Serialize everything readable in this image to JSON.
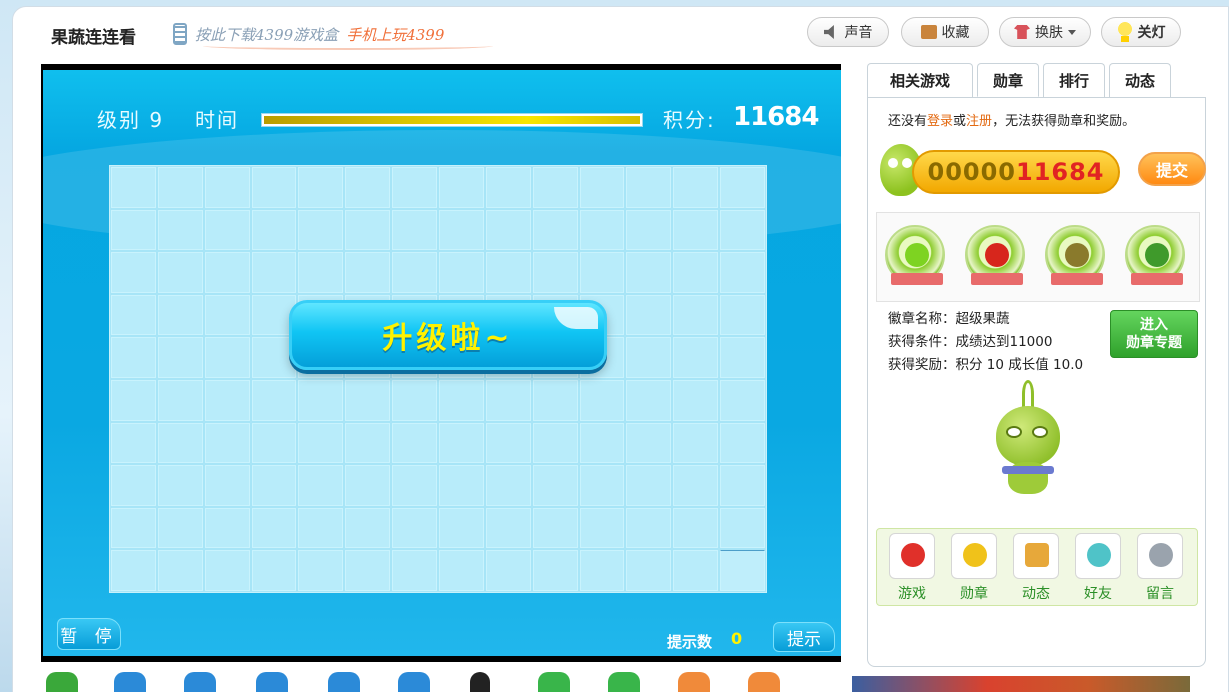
{
  "header": {
    "title": "果蔬连连看",
    "promo_text_1": "按此下载4399游戏盒",
    "promo_text_2": "手机上玩4399",
    "sound_label": "声音",
    "favorite_label": "收藏",
    "skin_label": "换肤",
    "light_label": "关灯"
  },
  "game": {
    "level_label": "级别 9",
    "time_label": "时间",
    "time_remaining_fraction": 1.0,
    "score_label": "积分:",
    "score": "11684",
    "levelup_text": "升级啦~",
    "pause_label": "暂 停",
    "hint_count_label": "提示数",
    "hint_count": "0",
    "hint_button_label": "提示",
    "board_columns": 14,
    "board_rows": 10
  },
  "side": {
    "tabs": [
      {
        "label": "相关游戏"
      },
      {
        "label": "勋章"
      },
      {
        "label": "排行"
      },
      {
        "label": "动态"
      }
    ],
    "notice_prefix": "还没有",
    "notice_login": "登录",
    "notice_or": "或",
    "notice_register": "注册",
    "notice_suffix": "，无法获得勋章和奖励。",
    "score_zeros": "00000",
    "score_digits": "11684",
    "submit_label": "提交",
    "badge_name": "徽章名称：超级果蔬",
    "badge_condition": "获得条件：成绩达到11000",
    "badge_reward": "获得奖励：积分  10  成长值  10.0",
    "enter_line_1": "进入",
    "enter_line_2": "勋章专题",
    "quick_links": [
      {
        "label": "游戏",
        "icon": "joystick-icon"
      },
      {
        "label": "勋章",
        "icon": "medal-icon"
      },
      {
        "label": "动态",
        "icon": "megaphone-icon"
      },
      {
        "label": "好友",
        "icon": "friends-icon"
      },
      {
        "label": "留言",
        "icon": "chat-bubble-icon"
      }
    ]
  },
  "colors": {
    "game_blue": "#05a7e1",
    "score_yellow": "#fff200",
    "link_orange": "#e36a12",
    "green_accent": "#2b8f27"
  }
}
